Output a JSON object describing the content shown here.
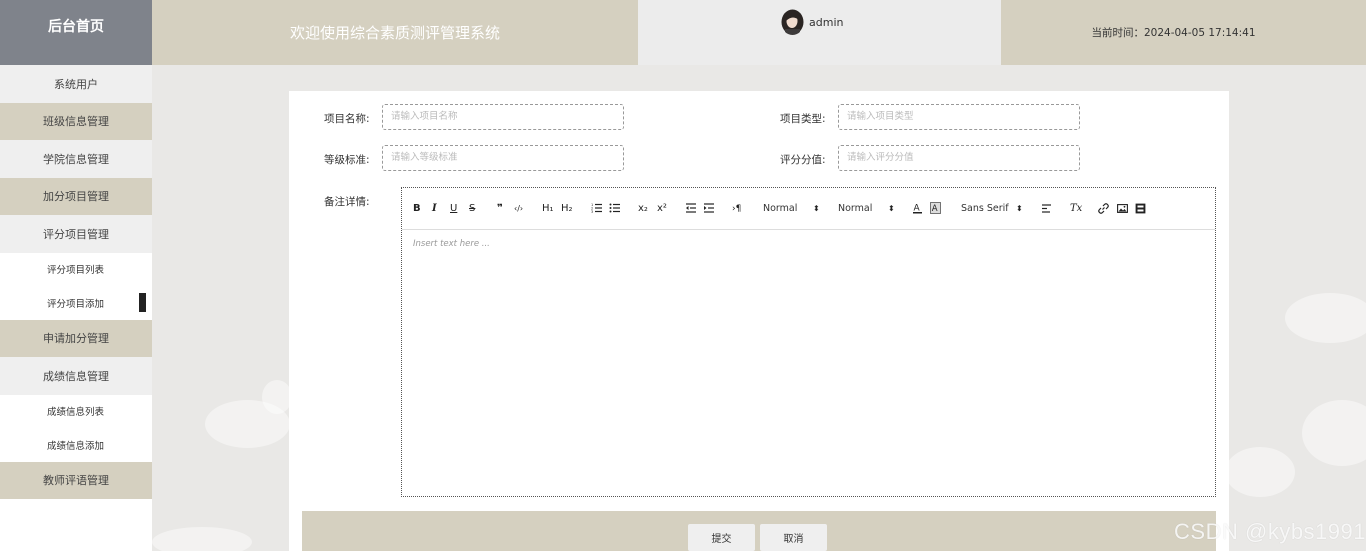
{
  "header": {
    "brand": "后台首页",
    "title": "欢迎使用综合素质测评管理系统",
    "username": "admin",
    "time_label": "当前时间：",
    "time_value": "2024-04-05 17:14:41"
  },
  "sidebar": {
    "items": [
      {
        "label": "系统用户"
      },
      {
        "label": "班级信息管理"
      },
      {
        "label": "学院信息管理"
      },
      {
        "label": "加分项目管理"
      },
      {
        "label": "评分项目管理"
      },
      {
        "label": "评分项目列表"
      },
      {
        "label": "评分项目添加"
      },
      {
        "label": "申请加分管理"
      },
      {
        "label": "成绩信息管理"
      },
      {
        "label": "成绩信息列表"
      },
      {
        "label": "成绩信息添加"
      },
      {
        "label": "教师评语管理"
      }
    ]
  },
  "form": {
    "name_label": "项目名称:",
    "name_placeholder": "请输入项目名称",
    "type_label": "项目类型:",
    "type_placeholder": "请输入项目类型",
    "level_label": "等级标准:",
    "level_placeholder": "请输入等级标准",
    "score_label": "评分分值:",
    "score_placeholder": "请输入评分分值",
    "remark_label": "备注详情:"
  },
  "editor": {
    "placeholder": "Insert text here ...",
    "toolbar": {
      "bold": "B",
      "italic": "I",
      "underline": "U",
      "strike": "S",
      "blockquote": "❞",
      "code": "‹/›",
      "h1": "H₁",
      "h2": "H₂",
      "subscript": "x₂",
      "superscript": "x²",
      "direction": "›¶",
      "size_select": "Normal",
      "header_select": "Normal",
      "font_select": "Sans Serif",
      "clean": "Tx"
    }
  },
  "actions": {
    "submit": "提交",
    "cancel": "取消"
  },
  "watermark": "CSDN @kybs1991",
  "colors": {
    "accent": "#d5d0c0",
    "brand_bg": "#7f838b",
    "page_bg": "#e9e8e6"
  }
}
